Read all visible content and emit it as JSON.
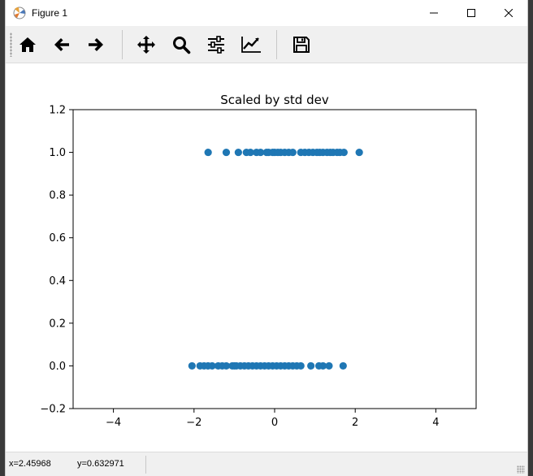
{
  "window": {
    "title": "Figure 1",
    "controls": [
      "minimize-icon",
      "maximize-icon",
      "close-icon"
    ]
  },
  "toolbar": {
    "buttons": [
      {
        "name": "home-button",
        "icon": "home-icon"
      },
      {
        "name": "back-button",
        "icon": "arrow-left-icon"
      },
      {
        "name": "forward-button",
        "icon": "arrow-right-icon"
      },
      {
        "name": "pan-button",
        "icon": "move-icon"
      },
      {
        "name": "zoom-button",
        "icon": "magnifier-icon"
      },
      {
        "name": "subplots-button",
        "icon": "sliders-icon"
      },
      {
        "name": "edit-axis-button",
        "icon": "line-chart-icon"
      },
      {
        "name": "save-button",
        "icon": "floppy-disk-icon"
      }
    ]
  },
  "status": {
    "x_text": "x=2.45968",
    "y_text": "y=0.632971"
  },
  "chart_data": {
    "type": "scatter",
    "title": "Scaled by std dev",
    "xlabel": "",
    "ylabel": "",
    "xlim": [
      -5,
      5
    ],
    "ylim": [
      -0.2,
      1.2
    ],
    "x_ticks": [
      -4,
      -2,
      0,
      2,
      4
    ],
    "x_tick_labels": [
      "−4",
      "−2",
      "0",
      "2",
      "4"
    ],
    "y_ticks": [
      -0.2,
      0.0,
      0.2,
      0.4,
      0.6,
      0.8,
      1.0,
      1.2
    ],
    "y_tick_labels": [
      "−0.2",
      "0.0",
      "0.2",
      "0.4",
      "0.6",
      "0.8",
      "1.0",
      "1.2"
    ],
    "marker_color": "#1f77b4",
    "grid": false,
    "points": [
      {
        "x": -1.65,
        "y": 1
      },
      {
        "x": -1.2,
        "y": 1
      },
      {
        "x": -0.9,
        "y": 1
      },
      {
        "x": -0.7,
        "y": 1
      },
      {
        "x": -0.6,
        "y": 1
      },
      {
        "x": -0.45,
        "y": 1
      },
      {
        "x": -0.35,
        "y": 1
      },
      {
        "x": -0.2,
        "y": 1
      },
      {
        "x": -0.15,
        "y": 1
      },
      {
        "x": -0.05,
        "y": 1
      },
      {
        "x": 0.0,
        "y": 1
      },
      {
        "x": 0.08,
        "y": 1
      },
      {
        "x": 0.15,
        "y": 1
      },
      {
        "x": 0.25,
        "y": 1
      },
      {
        "x": 0.35,
        "y": 1
      },
      {
        "x": 0.45,
        "y": 1
      },
      {
        "x": 0.65,
        "y": 1
      },
      {
        "x": 0.75,
        "y": 1
      },
      {
        "x": 0.85,
        "y": 1
      },
      {
        "x": 0.95,
        "y": 1
      },
      {
        "x": 1.05,
        "y": 1
      },
      {
        "x": 1.12,
        "y": 1
      },
      {
        "x": 1.2,
        "y": 1
      },
      {
        "x": 1.3,
        "y": 1
      },
      {
        "x": 1.38,
        "y": 1
      },
      {
        "x": 1.45,
        "y": 1
      },
      {
        "x": 1.55,
        "y": 1
      },
      {
        "x": 1.62,
        "y": 1
      },
      {
        "x": 1.72,
        "y": 1
      },
      {
        "x": 2.1,
        "y": 1
      },
      {
        "x": -2.05,
        "y": 0
      },
      {
        "x": -1.85,
        "y": 0
      },
      {
        "x": -1.75,
        "y": 0
      },
      {
        "x": -1.65,
        "y": 0
      },
      {
        "x": -1.55,
        "y": 0
      },
      {
        "x": -1.4,
        "y": 0
      },
      {
        "x": -1.3,
        "y": 0
      },
      {
        "x": -1.2,
        "y": 0
      },
      {
        "x": -1.05,
        "y": 0
      },
      {
        "x": -1.0,
        "y": 0
      },
      {
        "x": -0.95,
        "y": 0
      },
      {
        "x": -0.85,
        "y": 0
      },
      {
        "x": -0.75,
        "y": 0
      },
      {
        "x": -0.65,
        "y": 0
      },
      {
        "x": -0.55,
        "y": 0
      },
      {
        "x": -0.45,
        "y": 0
      },
      {
        "x": -0.35,
        "y": 0
      },
      {
        "x": -0.25,
        "y": 0
      },
      {
        "x": -0.15,
        "y": 0
      },
      {
        "x": -0.05,
        "y": 0
      },
      {
        "x": 0.05,
        "y": 0
      },
      {
        "x": 0.15,
        "y": 0
      },
      {
        "x": 0.25,
        "y": 0
      },
      {
        "x": 0.35,
        "y": 0
      },
      {
        "x": 0.45,
        "y": 0
      },
      {
        "x": 0.55,
        "y": 0
      },
      {
        "x": 0.65,
        "y": 0
      },
      {
        "x": 0.9,
        "y": 0
      },
      {
        "x": 1.1,
        "y": 0
      },
      {
        "x": 1.2,
        "y": 0
      },
      {
        "x": 1.35,
        "y": 0
      },
      {
        "x": 1.7,
        "y": 0
      }
    ]
  }
}
